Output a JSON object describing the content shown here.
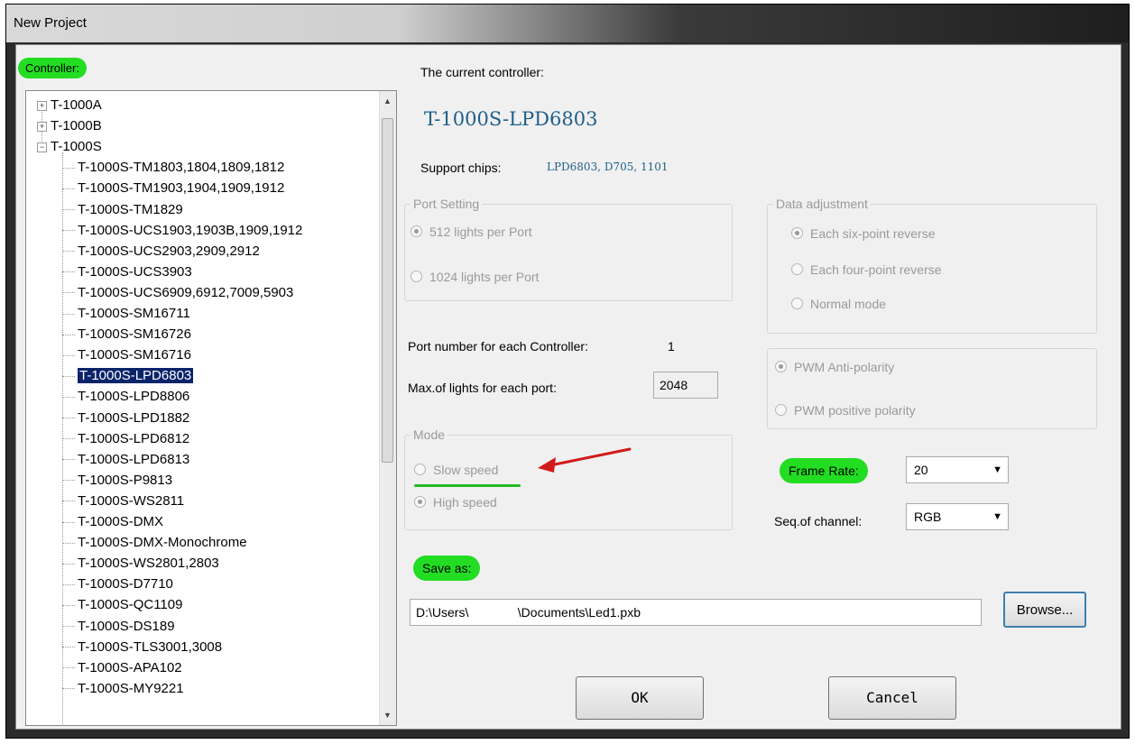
{
  "window": {
    "title": "New Project"
  },
  "tags": {
    "controller": "Controller:",
    "frame_rate": "Frame Rate:",
    "save_as": "Save as:"
  },
  "tree": {
    "parents": [
      {
        "label": "T-1000A",
        "expander": "+"
      },
      {
        "label": "T-1000B",
        "expander": "+"
      },
      {
        "label": "T-1000S",
        "expander": "−"
      }
    ],
    "children": [
      "T-1000S-TM1803,1804,1809,1812",
      "T-1000S-TM1903,1904,1909,1912",
      "T-1000S-TM1829",
      "T-1000S-UCS1903,1903B,1909,1912",
      "T-1000S-UCS2903,2909,2912",
      "T-1000S-UCS3903",
      "T-1000S-UCS6909,6912,7009,5903",
      "T-1000S-SM16711",
      "T-1000S-SM16726",
      "T-1000S-SM16716",
      "T-1000S-LPD6803",
      "T-1000S-LPD8806",
      "T-1000S-LPD1882",
      "T-1000S-LPD6812",
      "T-1000S-LPD6813",
      "T-1000S-P9813",
      "T-1000S-WS2811",
      "T-1000S-DMX",
      "T-1000S-DMX-Monochrome",
      "T-1000S-WS2801,2803",
      "T-1000S-D7710",
      "T-1000S-QC1109",
      "T-1000S-DS189",
      "T-1000S-TLS3001,3008",
      "T-1000S-APA102",
      "T-1000S-MY9221"
    ],
    "selected": "T-1000S-LPD6803"
  },
  "current": {
    "label": "The current controller:",
    "name": "T-1000S-LPD6803",
    "support_label": "Support chips:",
    "support_value": "LPD6803, D705, 1101"
  },
  "port_setting": {
    "title": "Port Setting",
    "options": [
      {
        "label": "512 lights per Port",
        "checked": true
      },
      {
        "label": "1024 lights per Port",
        "checked": false
      }
    ]
  },
  "data_adjustment": {
    "title": "Data adjustment",
    "options": [
      {
        "label": "Each six-point reverse",
        "checked": true
      },
      {
        "label": "Each four-point reverse",
        "checked": false
      },
      {
        "label": "Normal mode",
        "checked": false
      }
    ]
  },
  "port_number": {
    "label": "Port number for each Controller:",
    "value": "1"
  },
  "max_lights": {
    "label": "Max.of lights for each port:",
    "value": "2048"
  },
  "pwm": {
    "options": [
      {
        "label": "PWM Anti-polarity",
        "checked": true
      },
      {
        "label": "PWM positive polarity",
        "checked": false
      }
    ]
  },
  "mode": {
    "title": "Mode",
    "options": [
      {
        "label": "Slow speed",
        "checked": false
      },
      {
        "label": "High speed",
        "checked": true
      }
    ]
  },
  "frame_rate": {
    "value": "20"
  },
  "seq_channel": {
    "label": "Seq.of channel:",
    "value": "RGB"
  },
  "save_path": {
    "value": "D:\\Users\\              \\Documents\\Led1.pxb"
  },
  "buttons": {
    "browse": "Browse...",
    "ok": "OK",
    "cancel": "Cancel"
  },
  "colors": {
    "highlight": "#22dd22",
    "arrow": "#d11a1a",
    "selection": "#0a246a",
    "controller_name": "#1f5f8b"
  }
}
